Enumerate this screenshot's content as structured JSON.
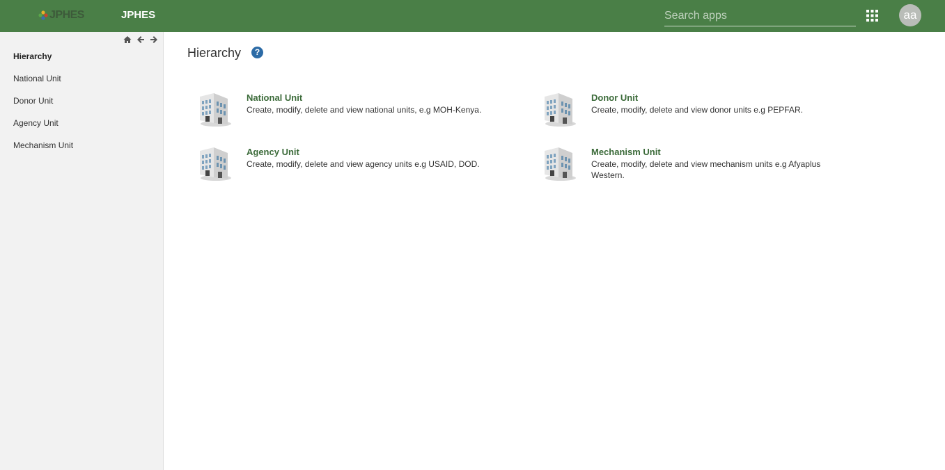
{
  "header": {
    "logo_text": "JPHES",
    "app_title": "JPHES",
    "search_placeholder": "Search apps",
    "avatar_initials": "aa",
    "apps_icon": "apps-grid-icon",
    "brand_color": "#4a7f47"
  },
  "sidebar": {
    "nav_icons": [
      "home-icon",
      "back-arrow-icon",
      "forward-arrow-icon"
    ],
    "items": [
      {
        "label": "Hierarchy",
        "active": true
      },
      {
        "label": "National Unit"
      },
      {
        "label": "Donor Unit"
      },
      {
        "label": "Agency Unit"
      },
      {
        "label": "Mechanism Unit"
      }
    ]
  },
  "main": {
    "title": "Hierarchy",
    "help_icon": "?",
    "cards": [
      {
        "title": "National Unit",
        "description": "Create, modify, delete and view national units, e.g MOH-Kenya."
      },
      {
        "title": "Donor Unit",
        "description": "Create, modify, delete and view donor units e.g PEPFAR."
      },
      {
        "title": "Agency Unit",
        "description": "Create, modify, delete and view agency units e.g USAID, DOD."
      },
      {
        "title": "Mechanism Unit",
        "description": "Create, modify, delete and view mechanism units e.g Afyaplus Western."
      }
    ]
  }
}
